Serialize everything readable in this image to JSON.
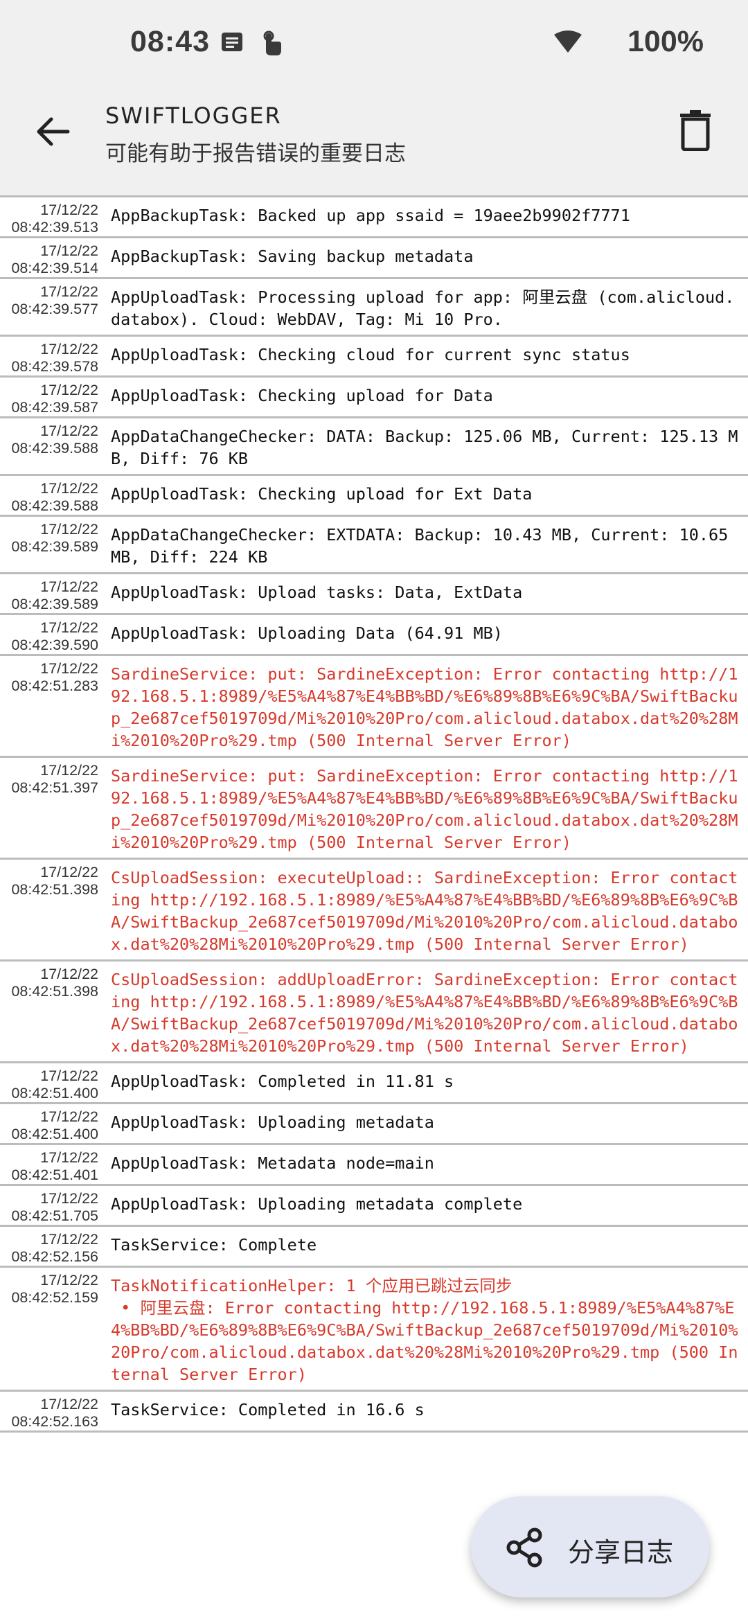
{
  "status_bar": {
    "time": "08:43",
    "battery": "100%"
  },
  "app_bar": {
    "title": "SWIFTLOGGER",
    "subtitle": "可能有助于报告错误的重要日志"
  },
  "logs": [
    {
      "date": "17/12/22",
      "time": "08:42:39.513",
      "message": "AppBackupTask: Backed up app ssaid = 19aee2b9902f7771",
      "error": false
    },
    {
      "date": "17/12/22",
      "time": "08:42:39.514",
      "message": "AppBackupTask: Saving backup metadata",
      "error": false
    },
    {
      "date": "17/12/22",
      "time": "08:42:39.577",
      "message": "AppUploadTask: Processing upload for app: 阿里云盘 (com.alicloud.databox). Cloud: WebDAV, Tag: Mi 10 Pro.",
      "error": false
    },
    {
      "date": "17/12/22",
      "time": "08:42:39.578",
      "message": "AppUploadTask: Checking cloud for current sync status",
      "error": false
    },
    {
      "date": "17/12/22",
      "time": "08:42:39.587",
      "message": "AppUploadTask: Checking upload for Data",
      "error": false
    },
    {
      "date": "17/12/22",
      "time": "08:42:39.588",
      "message": "AppDataChangeChecker: DATA: Backup: 125.06 MB, Current: 125.13 MB, Diff: 76 KB",
      "error": false
    },
    {
      "date": "17/12/22",
      "time": "08:42:39.588",
      "message": "AppUploadTask: Checking upload for Ext Data",
      "error": false
    },
    {
      "date": "17/12/22",
      "time": "08:42:39.589",
      "message": "AppDataChangeChecker: EXTDATA: Backup: 10.43 MB, Current: 10.65 MB, Diff: 224 KB",
      "error": false
    },
    {
      "date": "17/12/22",
      "time": "08:42:39.589",
      "message": "AppUploadTask: Upload tasks: Data, ExtData",
      "error": false
    },
    {
      "date": "17/12/22",
      "time": "08:42:39.590",
      "message": "AppUploadTask: Uploading Data (64.91 MB)",
      "error": false
    },
    {
      "date": "17/12/22",
      "time": "08:42:51.283",
      "message": "SardineService: put: SardineException: Error contacting http://192.168.5.1:8989/%E5%A4%87%E4%BB%BD/%E6%89%8B%E6%9C%BA/SwiftBackup_2e687cef5019709d/Mi%2010%20Pro/com.alicloud.databox.dat%20%28Mi%2010%20Pro%29.tmp (500 Internal Server Error)",
      "error": true
    },
    {
      "date": "17/12/22",
      "time": "08:42:51.397",
      "message": "SardineService: put: SardineException: Error contacting http://192.168.5.1:8989/%E5%A4%87%E4%BB%BD/%E6%89%8B%E6%9C%BA/SwiftBackup_2e687cef5019709d/Mi%2010%20Pro/com.alicloud.databox.dat%20%28Mi%2010%20Pro%29.tmp (500 Internal Server Error)",
      "error": true
    },
    {
      "date": "17/12/22",
      "time": "08:42:51.398",
      "message": "CsUploadSession: executeUpload:: SardineException: Error contacting http://192.168.5.1:8989/%E5%A4%87%E4%BB%BD/%E6%89%8B%E6%9C%BA/SwiftBackup_2e687cef5019709d/Mi%2010%20Pro/com.alicloud.databox.dat%20%28Mi%2010%20Pro%29.tmp (500 Internal Server Error)",
      "error": true
    },
    {
      "date": "17/12/22",
      "time": "08:42:51.398",
      "message": "CsUploadSession: addUploadError: SardineException: Error contacting http://192.168.5.1:8989/%E5%A4%87%E4%BB%BD/%E6%89%8B%E6%9C%BA/SwiftBackup_2e687cef5019709d/Mi%2010%20Pro/com.alicloud.databox.dat%20%28Mi%2010%20Pro%29.tmp (500 Internal Server Error)",
      "error": true
    },
    {
      "date": "17/12/22",
      "time": "08:42:51.400",
      "message": "AppUploadTask: Completed in 11.81 s",
      "error": false
    },
    {
      "date": "17/12/22",
      "time": "08:42:51.400",
      "message": "AppUploadTask: Uploading metadata",
      "error": false
    },
    {
      "date": "17/12/22",
      "time": "08:42:51.401",
      "message": "AppUploadTask: Metadata node=main",
      "error": false
    },
    {
      "date": "17/12/22",
      "time": "08:42:51.705",
      "message": "AppUploadTask: Uploading metadata complete",
      "error": false
    },
    {
      "date": "17/12/22",
      "time": "08:42:52.156",
      "message": "TaskService: Complete",
      "error": false
    },
    {
      "date": "17/12/22",
      "time": "08:42:52.159",
      "message": "TaskNotificationHelper: 1 个应用已跳过云同步\n • 阿里云盘: Error contacting http://192.168.5.1:8989/%E5%A4%87%E4%BB%BD/%E6%89%8B%E6%9C%BA/SwiftBackup_2e687cef5019709d/Mi%2010%20Pro/com.alicloud.databox.dat%20%28Mi%2010%20Pro%29.tmp (500 Internal Server Error)",
      "error": true
    },
    {
      "date": "17/12/22",
      "time": "08:42:52.163",
      "message": "TaskService: Completed in 16.6 s",
      "error": false
    }
  ],
  "fab": {
    "label": "分享日志"
  },
  "icons": {
    "back": "arrow-left-icon",
    "delete": "trash-icon",
    "share": "share-icon"
  },
  "colors": {
    "error_text": "#d63a2c",
    "fab_bg": "#e3e6f3",
    "app_bar_bg": "#f0f0f0"
  }
}
